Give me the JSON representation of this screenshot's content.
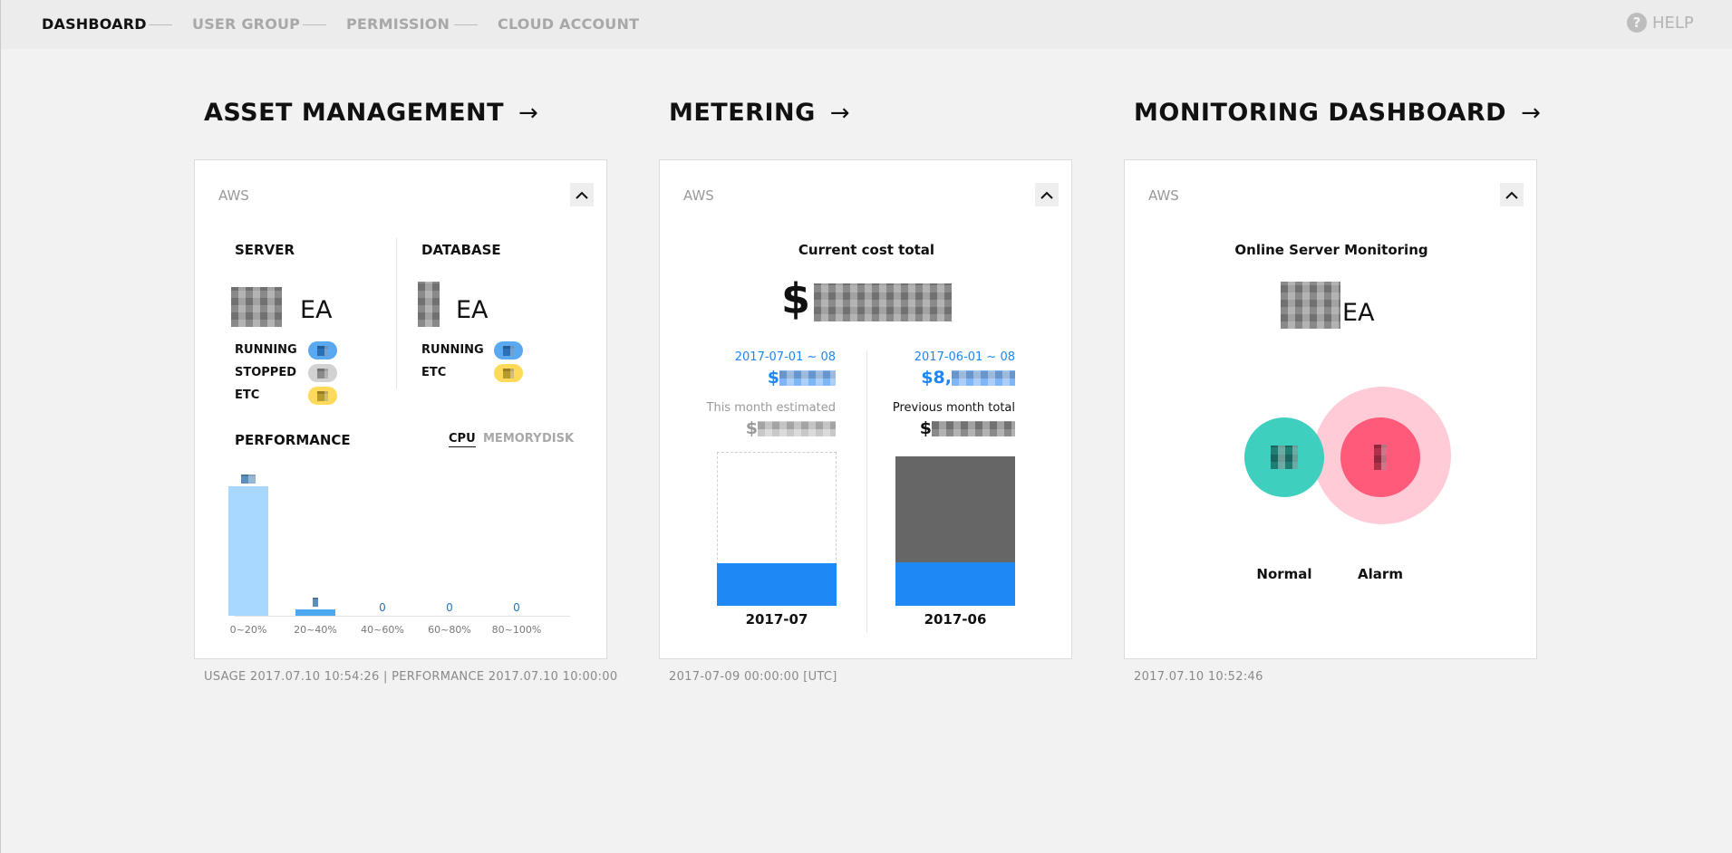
{
  "nav": {
    "items": [
      {
        "label": "DASHBOARD",
        "active": true
      },
      {
        "label": "USER GROUP",
        "active": false
      },
      {
        "label": "PERMISSION",
        "active": false
      },
      {
        "label": "CLOUD ACCOUNT",
        "active": false
      }
    ],
    "help_label": "HELP"
  },
  "sections": {
    "asset": {
      "title": "ASSET MANAGEMENT",
      "arrow": "→"
    },
    "metering": {
      "title": "METERING",
      "arrow": "→"
    },
    "monitoring": {
      "title": "MONITORING DASHBOARD",
      "arrow": "→"
    }
  },
  "asset_card": {
    "provider": "AWS",
    "server": {
      "label": "SERVER",
      "unit": "EA",
      "running": "RUNNING",
      "stopped": "STOPPED",
      "etc": "ETC"
    },
    "database": {
      "label": "DATABASE",
      "unit": "EA",
      "running": "RUNNING",
      "etc": "ETC"
    },
    "performance": {
      "label": "PERFORMANCE",
      "tabs": [
        "CPU",
        "MEMORY",
        "DISK"
      ],
      "active_tab": "CPU"
    },
    "footer": "USAGE 2017.07.10 10:54:26 | PERFORMANCE 2017.07.10 10:00:00"
  },
  "chart_data": {
    "type": "bar",
    "categories": [
      "0~20%",
      "20~40%",
      "40~60%",
      "60~80%",
      "80~100%"
    ],
    "values": [
      null,
      null,
      0,
      0,
      0
    ],
    "value_labels": [
      "",
      "",
      "0",
      "0",
      "0"
    ],
    "relative_fill": [
      1.0,
      0.05,
      0,
      0,
      0
    ],
    "colors": [
      "#a8d7ff",
      "#4ea8f0",
      "#4ea8f0",
      "#4ea8f0",
      "#4ea8f0"
    ]
  },
  "metering_card": {
    "provider": "AWS",
    "current_title": "Current cost total",
    "currency": "$",
    "left": {
      "date_range": "2017-07-01 ~ 08",
      "amount_prefix": "$",
      "estimate_label": "This month estimated",
      "estimate_prefix": "$",
      "period": "2017-07"
    },
    "right": {
      "date_range": "2017-06-01 ~ 08",
      "amount_prefix": "$",
      "amount_partial": "8,",
      "previous_label": "Previous month total",
      "previous_prefix": "$",
      "period": "2017-06"
    },
    "footer": "2017-07-09 00:00:00 [UTC]",
    "colors": {
      "accent": "#1e88f5",
      "dark": "#666666"
    }
  },
  "monitoring_card": {
    "provider": "AWS",
    "title": "Online Server Monitoring",
    "unit": "EA",
    "normal_label": "Normal",
    "alarm_label": "Alarm",
    "footer": "2017.07.10 10:52:46",
    "colors": {
      "normal": "#3ecfbf",
      "alarm": "#ff5a7a",
      "alarm_halo": "#ffcbd6"
    }
  }
}
